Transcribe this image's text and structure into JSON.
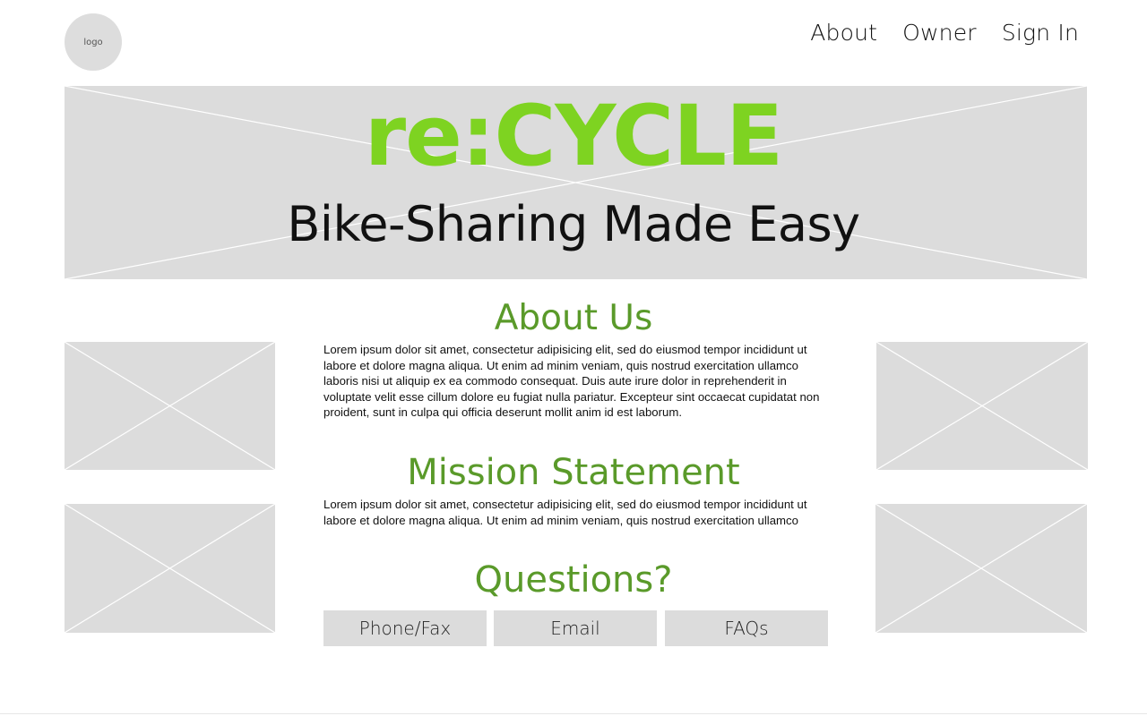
{
  "logo": {
    "label": "logo"
  },
  "nav": {
    "items": [
      {
        "label": "About"
      },
      {
        "label": "Owner"
      },
      {
        "label": "Sign In"
      }
    ]
  },
  "hero": {
    "brand": "re:CYCLE",
    "tagline": "Bike-Sharing Made Easy"
  },
  "about": {
    "heading": "About Us",
    "body": "Lorem ipsum dolor sit amet, consectetur adipisicing elit, sed do eiusmod tempor incididunt ut labore et dolore magna aliqua. Ut enim ad minim veniam, quis nostrud exercitation ullamco laboris nisi ut aliquip ex ea commodo consequat. Duis aute irure dolor in reprehenderit in voluptate velit esse cillum dolore eu fugiat nulla pariatur. Excepteur sint occaecat cupidatat non proident, sunt in culpa qui officia deserunt mollit anim id est laborum."
  },
  "mission": {
    "heading": "Mission Statement",
    "body": "Lorem ipsum dolor sit amet, consectetur adipisicing elit, sed do eiusmod tempor incididunt ut labore et dolore magna aliqua. Ut enim ad minim veniam, quis nostrud exercitation ullamco"
  },
  "questions": {
    "heading": "Questions?",
    "buttons": [
      {
        "label": "Phone/Fax"
      },
      {
        "label": "Email"
      },
      {
        "label": "FAQs"
      }
    ]
  },
  "colors": {
    "brand_green": "#7ed321",
    "heading_green": "#5a9a2a",
    "placeholder_gray": "#dcdcdc"
  }
}
